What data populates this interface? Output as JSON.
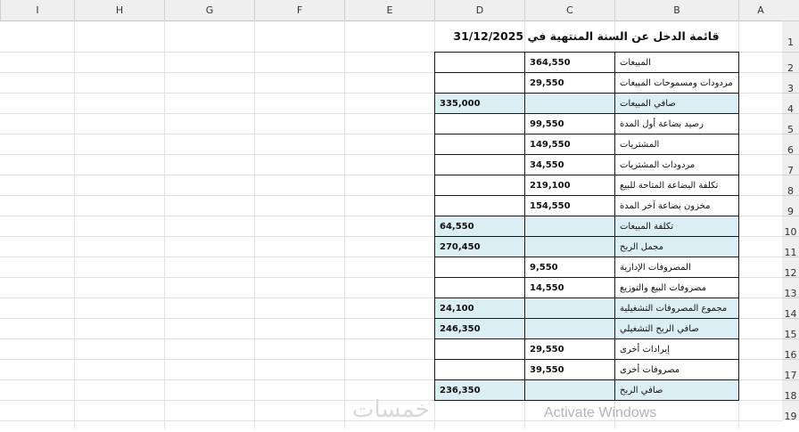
{
  "columns": [
    {
      "letter": "I"
    },
    {
      "letter": "H"
    },
    {
      "letter": "G"
    },
    {
      "letter": "F"
    },
    {
      "letter": "E"
    },
    {
      "letter": "D"
    },
    {
      "letter": "C"
    },
    {
      "letter": "B"
    },
    {
      "letter": "A"
    }
  ],
  "row_numbers": [
    "1",
    "2",
    "3",
    "4",
    "5",
    "6",
    "7",
    "8",
    "9",
    "10",
    "11",
    "12",
    "13",
    "14",
    "15",
    "16",
    "17",
    "18",
    "19"
  ],
  "statement": {
    "title": "قائمة الدخل عن السنة المنتهية في 31/12/2025",
    "rows": [
      {
        "label": "المبيعات",
        "c": "364,550",
        "d": "",
        "highlight": false
      },
      {
        "label": "مردودات ومسموحات المبيعات",
        "c": "29,550",
        "d": "",
        "highlight": false
      },
      {
        "label": "صافي المبيعات",
        "c": "",
        "d": "335,000",
        "highlight": true
      },
      {
        "label": "رصيد بضاعة أول المدة",
        "c": "99,550",
        "d": "",
        "highlight": false
      },
      {
        "label": "المشتريات",
        "c": "149,550",
        "d": "",
        "highlight": false
      },
      {
        "label": "مردودات المشتريات",
        "c": "34,550",
        "d": "",
        "highlight": false
      },
      {
        "label": "تكلفة البضاعة المتاحة للبيع",
        "c": "219,100",
        "d": "",
        "highlight": false
      },
      {
        "label": "مخزون بضاعة آخر المدة",
        "c": "154,550",
        "d": "",
        "highlight": false
      },
      {
        "label": "تكلفة المبيعات",
        "c": "",
        "d": "64,550",
        "highlight": true
      },
      {
        "label": "مجمل الربح",
        "c": "",
        "d": "270,450",
        "highlight": true
      },
      {
        "label": "المصروفات الإدارية",
        "c": "9,550",
        "d": "",
        "highlight": false
      },
      {
        "label": "مصروفات البيع والتوزيع",
        "c": "14,550",
        "d": "",
        "highlight": false
      },
      {
        "label": "مجموع المصروفات التشغيلية",
        "c": "",
        "d": "24,100",
        "highlight": true
      },
      {
        "label": "صافي الربح التشغيلي",
        "c": "",
        "d": "246,350",
        "highlight": true
      },
      {
        "label": "إيرادات أخرى",
        "c": "29,550",
        "d": "",
        "highlight": false
      },
      {
        "label": "مصروفات أخرى",
        "c": "39,550",
        "d": "",
        "highlight": false
      },
      {
        "label": "صافي الربح",
        "c": "",
        "d": "236,350",
        "highlight": true
      }
    ]
  },
  "watermark": {
    "logo_text": "خمسات",
    "activate": "Activate Windows"
  },
  "colors": {
    "highlight": "#dbeef4",
    "border": "#1a1a1a",
    "header_bg": "#efefef"
  }
}
